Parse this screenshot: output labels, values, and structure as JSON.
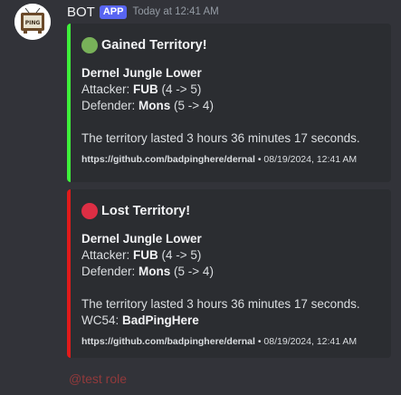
{
  "message": {
    "username": "BOT",
    "tag": "APP",
    "timestamp": "Today at 12:41 AM",
    "avatar_icon": "tv-logo-avatar",
    "avatar_text": "PING"
  },
  "embeds": [
    {
      "color": "#3ef03b",
      "icon_color": "#78b159",
      "icon": "green-circle-icon",
      "title": "Gained Territory!",
      "name": "Dernel Jungle Lower",
      "attacker_label": "Attacker: ",
      "attacker_name": "FUB",
      "attacker_change": " (4 -> 5)",
      "defender_label": "Defender: ",
      "defender_name": "Mons",
      "defender_change": " (5 -> 4)",
      "duration": "The territory lasted 3 hours 36 minutes 17 seconds.",
      "footer_url": "https://github.com/badpinghere/dernal",
      "footer_date": " • 08/19/2024, 12:41 AM"
    },
    {
      "color": "#e01b1b",
      "icon_color": "#dd2e44",
      "icon": "red-circle-icon",
      "title": "Lost Territory!",
      "name": "Dernel Jungle Lower",
      "attacker_label": "Attacker: ",
      "attacker_name": "FUB",
      "attacker_change": " (4 -> 5)",
      "defender_label": "Defender: ",
      "defender_name": "Mons",
      "defender_change": " (5 -> 4)",
      "duration": "The territory lasted 3 hours 36 minutes 17 seconds.",
      "extra_label": "WC54: ",
      "extra_value": "BadPingHere",
      "footer_url": "https://github.com/badpinghere/dernal",
      "footer_date": " • 08/19/2024, 12:41 AM"
    }
  ],
  "mention": "@test role"
}
